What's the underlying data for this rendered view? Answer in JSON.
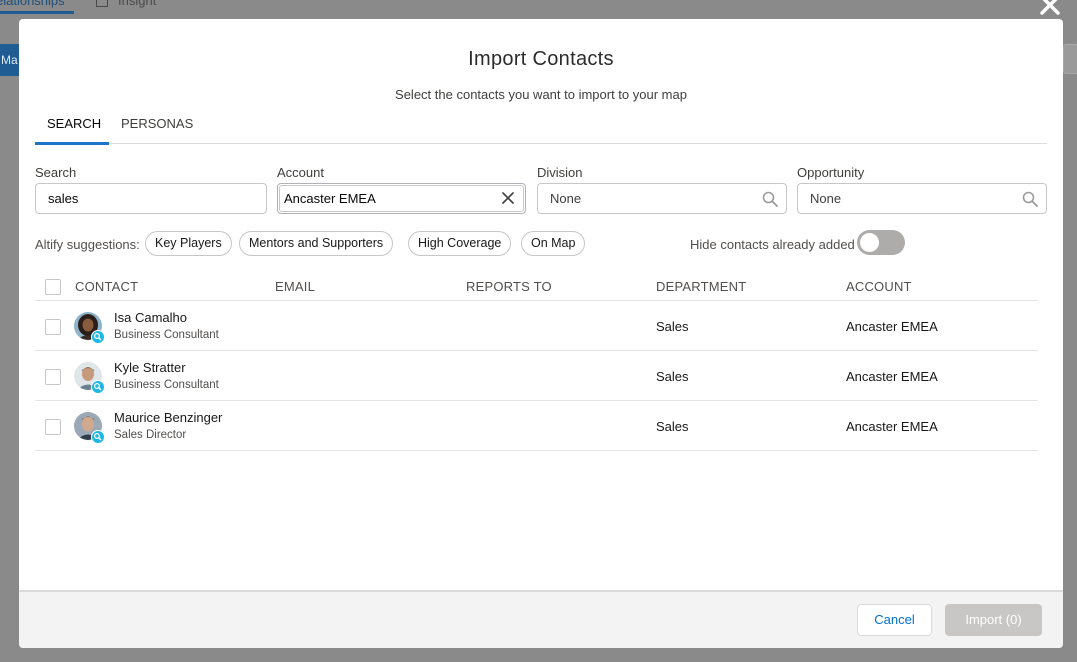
{
  "background": {
    "tabs": [
      {
        "label": "elationships"
      },
      {
        "label": "Insight"
      }
    ],
    "left_button": "Ma"
  },
  "modal": {
    "title": "Import Contacts",
    "subtitle": "Select the contacts you want to import to your map",
    "tabs": [
      {
        "label": "SEARCH",
        "active": true
      },
      {
        "label": "PERSONAS",
        "active": false
      }
    ],
    "filters": {
      "search": {
        "label": "Search",
        "value": "sales"
      },
      "account": {
        "label": "Account",
        "value": "Ancaster EMEA"
      },
      "division": {
        "label": "Division",
        "value": "None"
      },
      "opportunity": {
        "label": "Opportunity",
        "value": "None"
      }
    },
    "suggestions": {
      "label": "Altify suggestions:",
      "chips": [
        "Key Players",
        "Mentors and Supporters",
        "High Coverage",
        "On Map"
      ]
    },
    "hide_added": {
      "label": "Hide contacts already added",
      "on": false
    },
    "table": {
      "columns": [
        "CONTACT",
        "EMAIL",
        "REPORTS TO",
        "DEPARTMENT",
        "ACCOUNT"
      ],
      "rows": [
        {
          "name": "Isa Camalho",
          "title": "Business Consultant",
          "email": "",
          "reports_to": "",
          "department": "Sales",
          "account": "Ancaster EMEA"
        },
        {
          "name": "Kyle Stratter",
          "title": "Business Consultant",
          "email": "",
          "reports_to": "",
          "department": "Sales",
          "account": "Ancaster EMEA"
        },
        {
          "name": "Maurice Benzinger",
          "title": "Sales Director",
          "email": "",
          "reports_to": "",
          "department": "Sales",
          "account": "Ancaster EMEA"
        }
      ]
    },
    "footer": {
      "cancel_label": "Cancel",
      "import_label": "Import (0)"
    }
  },
  "colors": {
    "accent": "#1b74c8",
    "link": "#0070d2",
    "disabled_button": "#c9c7c5",
    "badge": "#1fb7e5"
  }
}
